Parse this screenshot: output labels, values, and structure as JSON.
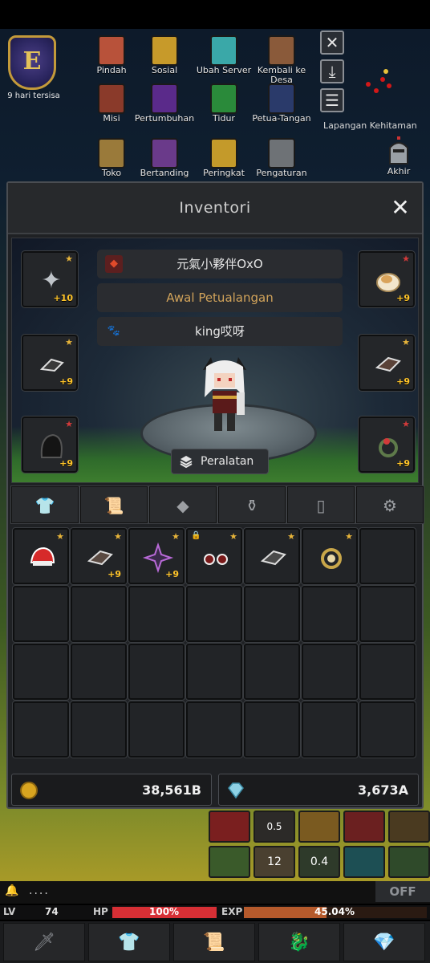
{
  "colors": {
    "panel_bg": "#1f2124",
    "gold": "#ffc428",
    "star_gold": "#e7b43a",
    "star_red": "#d23a3a",
    "hp": "#d62f35",
    "exp": "#b55a2c"
  },
  "event": {
    "label": "9 hari tersisa"
  },
  "top_menu": [
    {
      "label": "Pindah",
      "icon": "scroll-icon"
    },
    {
      "label": "Sosial",
      "icon": "people-icon"
    },
    {
      "label": "Ubah Server",
      "icon": "server-swap-icon"
    },
    {
      "label": "Kembali ke Desa",
      "icon": "house-icon"
    },
    {
      "label": "Misi",
      "icon": "quest-book-icon"
    },
    {
      "label": "Pertumbuhan",
      "icon": "growth-arrow-icon"
    },
    {
      "label": "Tidur",
      "icon": "battery-icon"
    },
    {
      "label": "Petua-Tangan",
      "icon": "guide-book-icon"
    },
    {
      "label": "Toko",
      "icon": "scales-icon"
    },
    {
      "label": "Bertanding",
      "icon": "crest-icon"
    },
    {
      "label": "Peringkat",
      "icon": "trophy-icon"
    },
    {
      "label": "Pengaturan",
      "icon": "gear-icon"
    }
  ],
  "side": {
    "map_label": "Lapangan Kehitaman",
    "exit_label": "Akhir"
  },
  "inventory": {
    "title": "Inventori",
    "character_name": "元氣小夥伴OxO",
    "character_title": "Awal Petualangan",
    "pet_name": "king哎呀",
    "equip_button": "Peralatan",
    "left_slots": [
      {
        "icon": "shuriken-icon",
        "star": "gold",
        "plus": "+10"
      },
      {
        "icon": "whetstone-icon",
        "star": "gold",
        "plus": "+9"
      },
      {
        "icon": "dark-cloak-icon",
        "star": "red",
        "plus": "+9"
      }
    ],
    "right_slots": [
      {
        "icon": "fur-hat-icon",
        "star": "red",
        "plus": "+9"
      },
      {
        "icon": "leather-stone-icon",
        "star": "gold",
        "plus": "+9"
      },
      {
        "icon": "jade-ring-icon",
        "star": "red",
        "plus": "+9"
      }
    ],
    "tabs": [
      {
        "name": "armor-tab",
        "icon": "shirt-icon"
      },
      {
        "name": "scroll-tab",
        "icon": "scroll-icon"
      },
      {
        "name": "gem-tab",
        "icon": "diamond-icon"
      },
      {
        "name": "potion-tab",
        "icon": "bottle-icon"
      },
      {
        "name": "card-tab",
        "icon": "card-icon"
      },
      {
        "name": "settings-tab",
        "icon": "gear-icon"
      }
    ],
    "items": [
      {
        "icon": "red-hat-icon",
        "star": true,
        "lock": false,
        "plus": ""
      },
      {
        "icon": "whetstone-icon",
        "star": true,
        "lock": false,
        "plus": "+9"
      },
      {
        "icon": "purple-shuriken-icon",
        "star": true,
        "lock": false,
        "plus": "+9"
      },
      {
        "icon": "earrings-icon",
        "star": true,
        "lock": true,
        "plus": ""
      },
      {
        "icon": "grey-stone-icon",
        "star": true,
        "lock": false,
        "plus": ""
      },
      {
        "icon": "gold-ring-icon",
        "star": true,
        "lock": false,
        "plus": ""
      }
    ],
    "gold": "38,561B",
    "gems": "3,673A"
  },
  "skills": [
    {
      "label": "0.5"
    },
    {
      "label": "12"
    },
    {
      "label": "0.4"
    }
  ],
  "chat": {
    "dots": "....",
    "toggle": "OFF"
  },
  "stats": {
    "lv_label": "LV",
    "lv": "74",
    "hp_label": "HP",
    "hp": "100%",
    "hp_frac": 1.0,
    "exp_label": "EXP",
    "exp": "45.04%",
    "exp_frac": 0.4504
  },
  "bottom_nav": [
    {
      "icon": "sword-icon"
    },
    {
      "icon": "shirt-icon"
    },
    {
      "icon": "scroll-icon"
    },
    {
      "icon": "dragon-icon"
    },
    {
      "icon": "gem-icon"
    }
  ]
}
